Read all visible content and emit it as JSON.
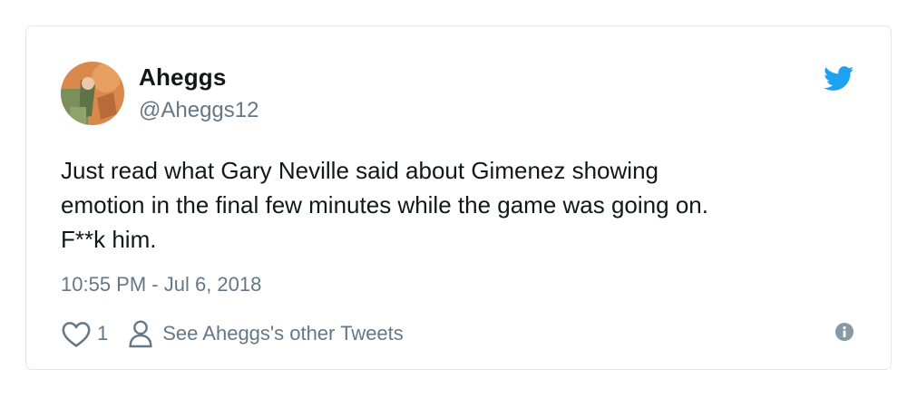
{
  "tweet": {
    "display_name": "Aheggs",
    "handle": "@Aheggs12",
    "text_lines": [
      "Just read what Gary Neville said about Gimenez showing",
      "emotion in the final few minutes while the game was going on.",
      "F**k him."
    ],
    "timestamp": "10:55 PM - Jul 6, 2018",
    "like_count": "1",
    "other_tweets_label": "See Aheggs's other Tweets"
  },
  "icons": {
    "brand": "twitter-bird-icon",
    "like": "heart-outline-icon",
    "profile": "person-outline-icon",
    "info": "info-circle-icon"
  },
  "colors": {
    "brand_blue": "#1da1f2",
    "text_primary": "#14171a",
    "text_secondary": "#657786",
    "border": "#e1e8ed"
  }
}
